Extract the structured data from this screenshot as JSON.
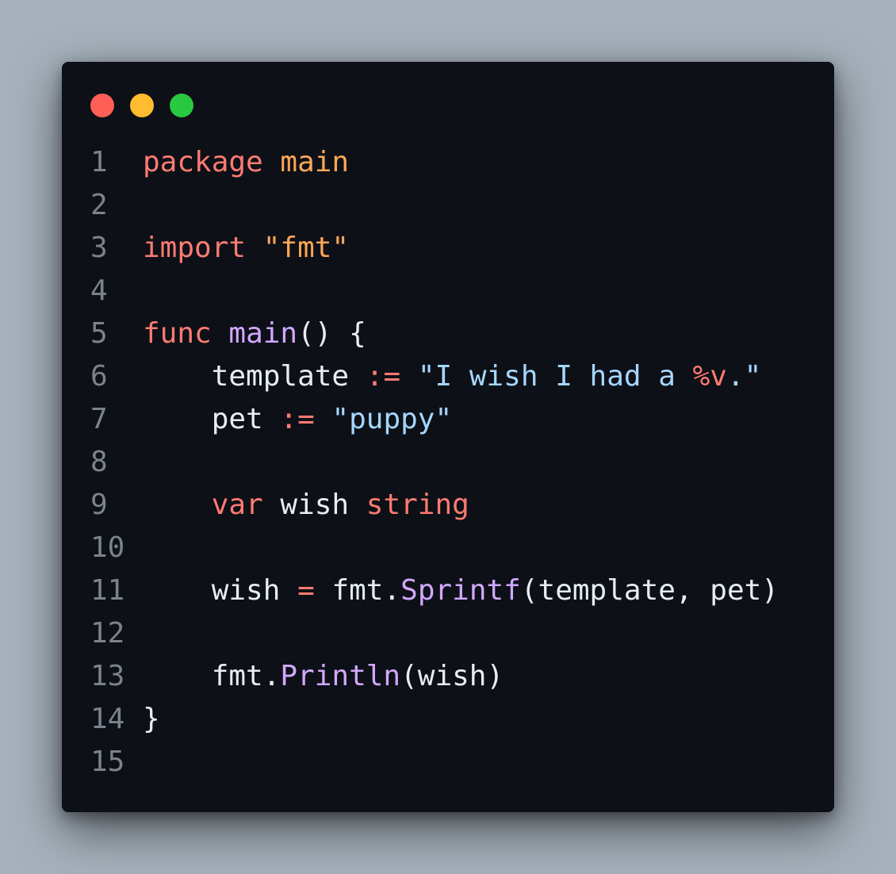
{
  "colors": {
    "background": "#a6b1bb",
    "window": "#0d1017",
    "line_number": "#7b838c",
    "default": "#e6edf3",
    "dot_red": "#ff5f57",
    "dot_yellow": "#febc2e",
    "dot_green": "#28c840"
  },
  "window_controls": [
    {
      "name": "close-dot",
      "icon": "red-circle",
      "color": "#ff5f57"
    },
    {
      "name": "minimize-dot",
      "icon": "yellow-circle",
      "color": "#febc2e"
    },
    {
      "name": "maximize-dot",
      "icon": "green-circle",
      "color": "#28c840"
    }
  ],
  "code": {
    "language": "go",
    "lines": [
      {
        "number": "1",
        "tokens": [
          {
            "text": "package",
            "color": "#ff7b72"
          },
          {
            "text": " ",
            "color": "#e6edf3"
          },
          {
            "text": "main",
            "color": "#ffa657"
          }
        ]
      },
      {
        "number": "2",
        "tokens": []
      },
      {
        "number": "3",
        "tokens": [
          {
            "text": "import",
            "color": "#ff7b72"
          },
          {
            "text": " ",
            "color": "#e6edf3"
          },
          {
            "text": "\"fmt\"",
            "color": "#ffa657"
          }
        ]
      },
      {
        "number": "4",
        "tokens": []
      },
      {
        "number": "5",
        "tokens": [
          {
            "text": "func",
            "color": "#ff7b72"
          },
          {
            "text": " ",
            "color": "#e6edf3"
          },
          {
            "text": "main",
            "color": "#d2a8ff"
          },
          {
            "text": "() {",
            "color": "#e6edf3"
          }
        ]
      },
      {
        "number": "6",
        "tokens": [
          {
            "text": "    template ",
            "color": "#e6edf3"
          },
          {
            "text": ":=",
            "color": "#ff7b72"
          },
          {
            "text": " ",
            "color": "#e6edf3"
          },
          {
            "text": "\"I wish I had a ",
            "color": "#a5d6ff"
          },
          {
            "text": "%v",
            "color": "#ff7b72"
          },
          {
            "text": ".\"",
            "color": "#a5d6ff"
          }
        ]
      },
      {
        "number": "7",
        "tokens": [
          {
            "text": "    pet ",
            "color": "#e6edf3"
          },
          {
            "text": ":=",
            "color": "#ff7b72"
          },
          {
            "text": " ",
            "color": "#e6edf3"
          },
          {
            "text": "\"puppy\"",
            "color": "#a5d6ff"
          }
        ]
      },
      {
        "number": "8",
        "tokens": []
      },
      {
        "number": "9",
        "tokens": [
          {
            "text": "    ",
            "color": "#e6edf3"
          },
          {
            "text": "var",
            "color": "#ff7b72"
          },
          {
            "text": " wish ",
            "color": "#e6edf3"
          },
          {
            "text": "string",
            "color": "#ff7b72"
          }
        ]
      },
      {
        "number": "10",
        "tokens": []
      },
      {
        "number": "11",
        "tokens": [
          {
            "text": "    wish ",
            "color": "#e6edf3"
          },
          {
            "text": "=",
            "color": "#ff7b72"
          },
          {
            "text": " fmt.",
            "color": "#e6edf3"
          },
          {
            "text": "Sprintf",
            "color": "#d2a8ff"
          },
          {
            "text": "(template, pet)",
            "color": "#e6edf3"
          }
        ]
      },
      {
        "number": "12",
        "tokens": []
      },
      {
        "number": "13",
        "tokens": [
          {
            "text": "    fmt.",
            "color": "#e6edf3"
          },
          {
            "text": "Println",
            "color": "#d2a8ff"
          },
          {
            "text": "(wish)",
            "color": "#e6edf3"
          }
        ]
      },
      {
        "number": "14",
        "tokens": [
          {
            "text": "}",
            "color": "#e6edf3"
          }
        ]
      },
      {
        "number": "15",
        "tokens": []
      }
    ]
  }
}
